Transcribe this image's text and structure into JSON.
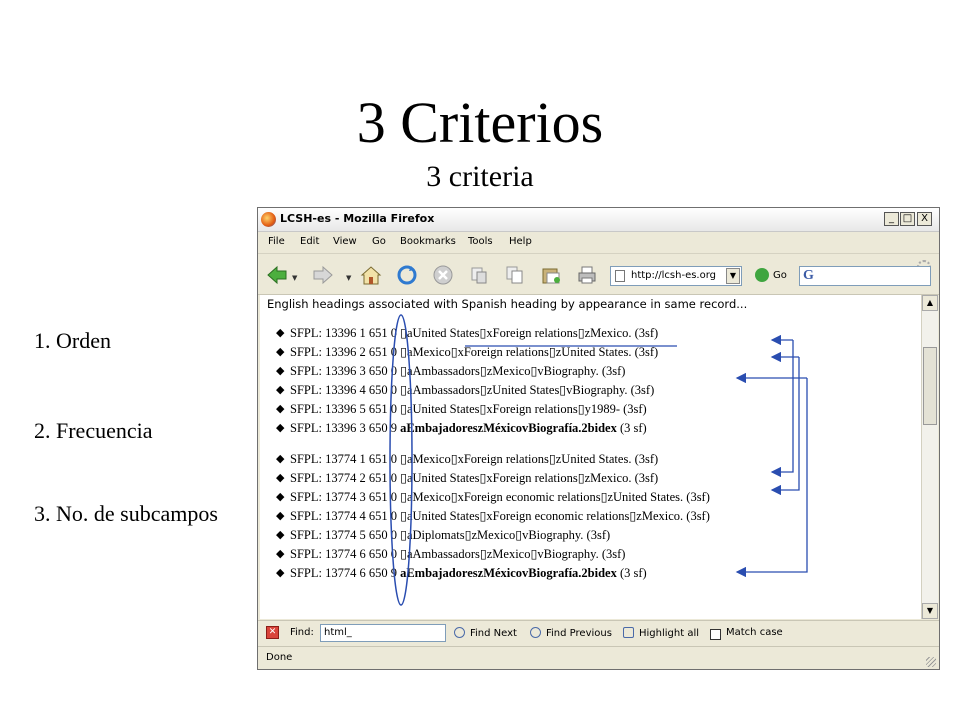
{
  "slide": {
    "title": "3 Criterios",
    "subtitle": "3 criteria",
    "criteria": [
      "1. Orden",
      "2. Frecuencia",
      "3. No. de subcampos"
    ]
  },
  "browser": {
    "window_title": "LCSH-es - Mozilla Firefox",
    "window_buttons": [
      "_",
      "□",
      "X"
    ],
    "menu": [
      "File",
      "Edit",
      "View",
      "Go",
      "Bookmarks",
      "Tools",
      "Help"
    ],
    "url": "http://lcsh-es.org",
    "go_label": "Go",
    "search_logo": "G",
    "content_header": "English headings associated with Spanish heading by appearance in same record...",
    "records": [
      {
        "head": "SFPL: 13396 1 651 0 ",
        "tail": "▯aUnited States▯xForeign relations▯zMexico. (3sf)",
        "bold": false
      },
      {
        "head": "SFPL: 13396 2 651 0 ",
        "tail": "▯aMexico▯xForeign relations▯zUnited States. (3sf)",
        "bold": false
      },
      {
        "head": "SFPL: 13396 3 650 0 ",
        "tail": "▯aAmbassadors▯zMexico▯vBiography. (3sf)",
        "bold": false
      },
      {
        "head": "SFPL: 13396 4 650 0 ",
        "tail": "▯aAmbassadors▯zUnited States▯vBiography. (3sf)",
        "bold": false
      },
      {
        "head": "SFPL: 13396 5 651 0 ",
        "tail": "▯aUnited States▯xForeign relations▯y1989- (3sf)",
        "bold": false
      },
      {
        "head": "SFPL: 13396 3 650 9 ",
        "tail": "aEmbajadoreszMéxicovBiografía.2bidex",
        "suffix": " (3 sf)",
        "bold": true
      },
      {
        "head": "SFPL: 13774 1 651 0 ",
        "tail": "▯aMexico▯xForeign relations▯zUnited States. (3sf)",
        "bold": false
      },
      {
        "head": "SFPL: 13774 2 651 0 ",
        "tail": "▯aUnited States▯xForeign relations▯zMexico. (3sf)",
        "bold": false
      },
      {
        "head": "SFPL: 13774 3 651 0 ",
        "tail": "▯aMexico▯xForeign economic relations▯zUnited States. (3sf)",
        "bold": false
      },
      {
        "head": "SFPL: 13774 4 651 0 ",
        "tail": "▯aUnited States▯xForeign economic relations▯zMexico. (3sf)",
        "bold": false
      },
      {
        "head": "SFPL: 13774 5 650 0 ",
        "tail": "▯aDiplomats▯zMexico▯vBiography. (3sf)",
        "bold": false
      },
      {
        "head": "SFPL: 13774 6 650 0 ",
        "tail": "▯aAmbassadors▯zMexico▯vBiography. (3sf)",
        "bold": false
      },
      {
        "head": "SFPL: 13774 6 650 9 ",
        "tail": "aEmbajadoreszMéxicovBiografía.2bidex",
        "suffix": " (3 sf)",
        "bold": true
      }
    ],
    "find": {
      "label": "Find:",
      "value": "html_",
      "next": "Find Next",
      "previous": "Find Previous",
      "highlight": "Highlight all",
      "match_case": "Match case",
      "match_case_checked": false
    },
    "status": "Done",
    "annotation_color": "#2a4db0"
  }
}
